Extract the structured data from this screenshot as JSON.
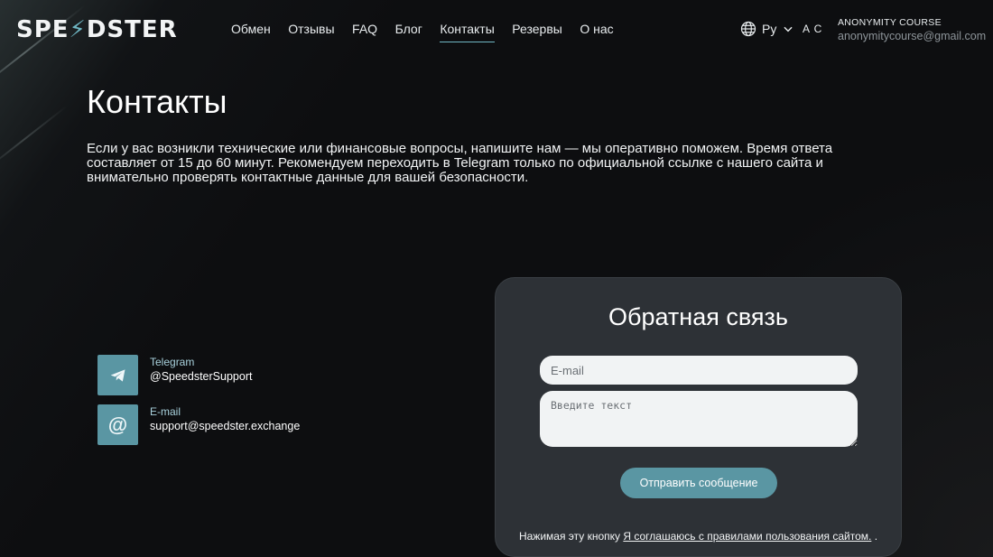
{
  "brand": {
    "logo_left": "SPE",
    "logo_bolt": "⚡",
    "logo_right": "DSTER"
  },
  "nav": [
    {
      "label": "Обмен"
    },
    {
      "label": "Отзывы"
    },
    {
      "label": "FAQ"
    },
    {
      "label": "Блог"
    },
    {
      "label": "Контакты",
      "active": true
    },
    {
      "label": "Резервы"
    },
    {
      "label": "О нас"
    }
  ],
  "lang": {
    "label": "Ру",
    "icon": "globe-icon"
  },
  "user": {
    "initials": "A C",
    "name": "ANONYMITY COURSE",
    "email": "anonymitycourse@gmail.com"
  },
  "page": {
    "title": "Контакты",
    "lead": "Если у вас возникли технические или финансовые вопросы, напишите нам — мы оперативно поможем. Время ответа составляет от 15 до 60 минут. Рекомендуем переходить в Telegram только по официальной ссылке с нашего сайта и внимательно проверять контактные данные для вашей безопасности."
  },
  "contacts": {
    "telegram": {
      "label": "Telegram",
      "value": "@SpeedsterSupport",
      "icon": "telegram-icon"
    },
    "email": {
      "label": "E-mail",
      "value": "support@speedster.exchange",
      "icon": "at-icon",
      "glyph": "@"
    }
  },
  "feedback": {
    "title": "Обратная связь",
    "email_placeholder": "E-mail",
    "message_placeholder": "Введите текст",
    "submit_label": "Отправить сообщение",
    "agree_prefix": "Нажимая эту кнопку ",
    "agree_link": "Я соглашаюсь с правилами пользования сайтом.",
    "agree_suffix": " ."
  },
  "colors": {
    "accent": "#5a96a3",
    "card": "#2d3136",
    "background": "#0d0e10"
  }
}
